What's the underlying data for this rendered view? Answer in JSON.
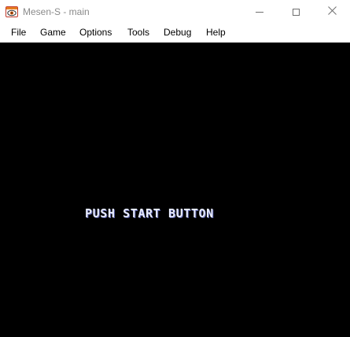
{
  "window": {
    "title": "Mesen-S - main",
    "icon": "mesen-eye-icon",
    "controls": {
      "minimize": "minimize-icon",
      "maximize": "maximize-icon",
      "close": "close-icon"
    }
  },
  "menu": {
    "items": [
      "File",
      "Game",
      "Options",
      "Tools",
      "Debug",
      "Help"
    ]
  },
  "game": {
    "screen_text": "PUSH START BUTTON",
    "background_color": "#000000",
    "text_color": "#e8ecff"
  }
}
